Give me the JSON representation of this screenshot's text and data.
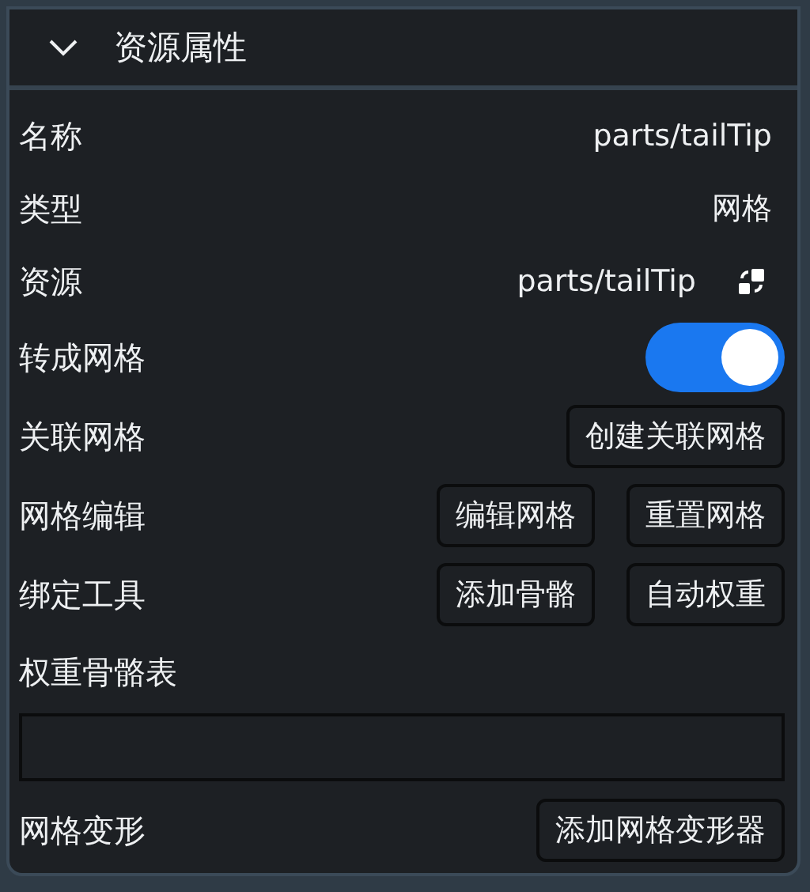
{
  "panel": {
    "title": "资源属性",
    "expanded": true
  },
  "rows": [
    {
      "kind": "text",
      "label": "名称",
      "value": "parts/tailTip"
    },
    {
      "kind": "text",
      "label": "类型",
      "value": "网格"
    },
    {
      "kind": "link",
      "label": "资源",
      "value": "parts/tailTip"
    },
    {
      "kind": "toggle",
      "label": "转成网格",
      "on": true
    },
    {
      "kind": "buttons",
      "label": "关联网格",
      "buttons": [
        "创建关联网格"
      ]
    },
    {
      "kind": "buttons",
      "label": "网格编辑",
      "buttons": [
        "编辑网格",
        "重置网格"
      ]
    },
    {
      "kind": "buttons",
      "label": "绑定工具",
      "buttons": [
        "添加骨骼",
        "自动权重"
      ]
    },
    {
      "kind": "list",
      "label": "权重骨骼表"
    },
    {
      "kind": "buttons",
      "label": "网格变形",
      "buttons": [
        "添加网格变形器"
      ]
    }
  ]
}
